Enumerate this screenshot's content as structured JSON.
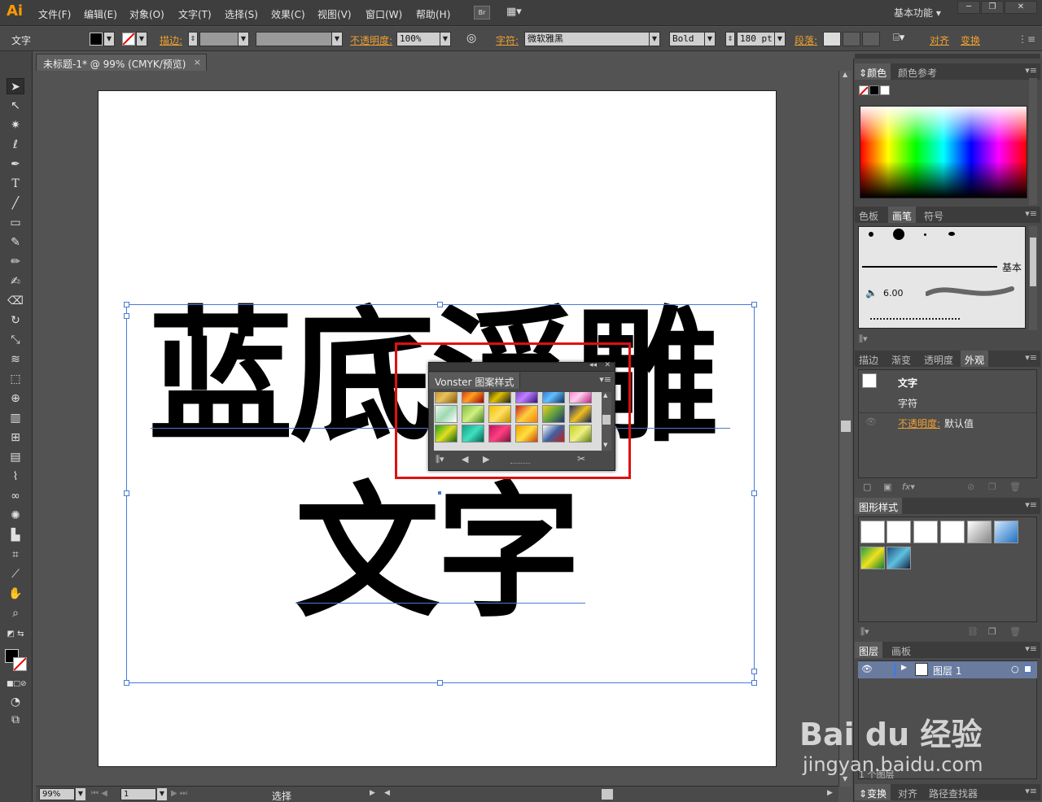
{
  "app": {
    "logo": "Ai"
  },
  "menu": [
    "文件(F)",
    "编辑(E)",
    "对象(O)",
    "文字(T)",
    "选择(S)",
    "效果(C)",
    "视图(V)",
    "窗口(W)",
    "帮助(H)"
  ],
  "menubar": {
    "bridge": "Br",
    "workspace": "基本功能 ▾"
  },
  "control": {
    "type_label": "文字",
    "stroke_label": "描边:",
    "opacity_label": "不透明度:",
    "opacity_value": "100%",
    "char_label": "字符:",
    "font_family": "微软雅黑",
    "font_style": "Bold",
    "font_size": "180 pt",
    "para_label": "段落:",
    "align_label": "对齐",
    "transform_label": "变换"
  },
  "document": {
    "tab_title": "未标题-1* @ 99% (CMYK/预览)",
    "close": "×"
  },
  "artwork": {
    "line1": "蓝底浮雕",
    "line2": "文字"
  },
  "pattern_panel": {
    "title": "Vonster 图案样式"
  },
  "status": {
    "zoom": "99%",
    "page": "1",
    "tool": "选择"
  },
  "right": {
    "color_tabs": [
      "颜色",
      "颜色参考"
    ],
    "brush_tabs": [
      "色板",
      "画笔",
      "符号"
    ],
    "brush_basic": "基本",
    "brush_size": "6.00",
    "appearance_tabs": [
      "描边",
      "渐变",
      "透明度",
      "外观"
    ],
    "appearance_title": "文字",
    "appearance_char": "字符",
    "appearance_opacity_label": "不透明度:",
    "appearance_opacity_value": "默认值",
    "graphic_styles_tab": "图形样式",
    "layers_tabs": [
      "图层",
      "画板"
    ],
    "layer_name": "图层 1",
    "layer_count": "1 个图层",
    "bottom_tabs": [
      "变换",
      "对齐",
      "路径查找器"
    ]
  },
  "watermark": {
    "brand": "Bai du 经验",
    "url": "jingyan.baidu.com"
  },
  "colors": {
    "accent": "#f0a030",
    "selection": "#4a7ad6",
    "highlight": "#e01010"
  }
}
